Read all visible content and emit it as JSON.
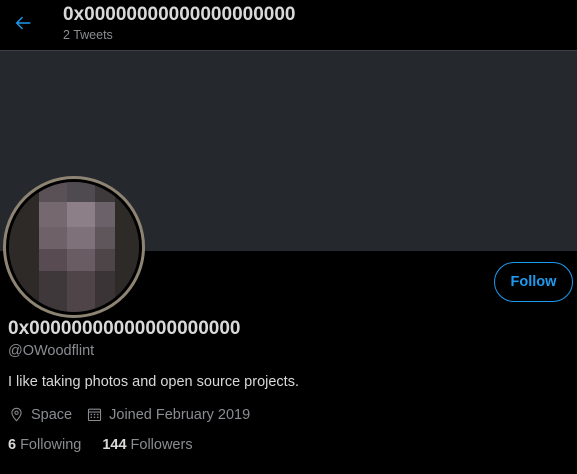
{
  "header": {
    "title": "0x00000000000000000000",
    "subtitle": "2 Tweets",
    "back_icon": "arrow-left-icon",
    "accent": "#1d9bf0"
  },
  "profile": {
    "display_name": "0x00000000000000000000",
    "handle": "@OWoodflint",
    "bio": "I like taking photos and open source projects.",
    "location": "Space",
    "joined": "Joined February 2019",
    "follow_label": "Follow",
    "following_count": "6",
    "following_label": "Following",
    "followers_count": "144",
    "followers_label": "Followers"
  },
  "icons": {
    "location": "location-pin-icon",
    "calendar": "calendar-icon"
  },
  "colors": {
    "background": "#000000",
    "banner": "#25282c",
    "text": "#d9d9d9",
    "muted": "#8a8d91",
    "avatar_ring": "#8e8473"
  }
}
